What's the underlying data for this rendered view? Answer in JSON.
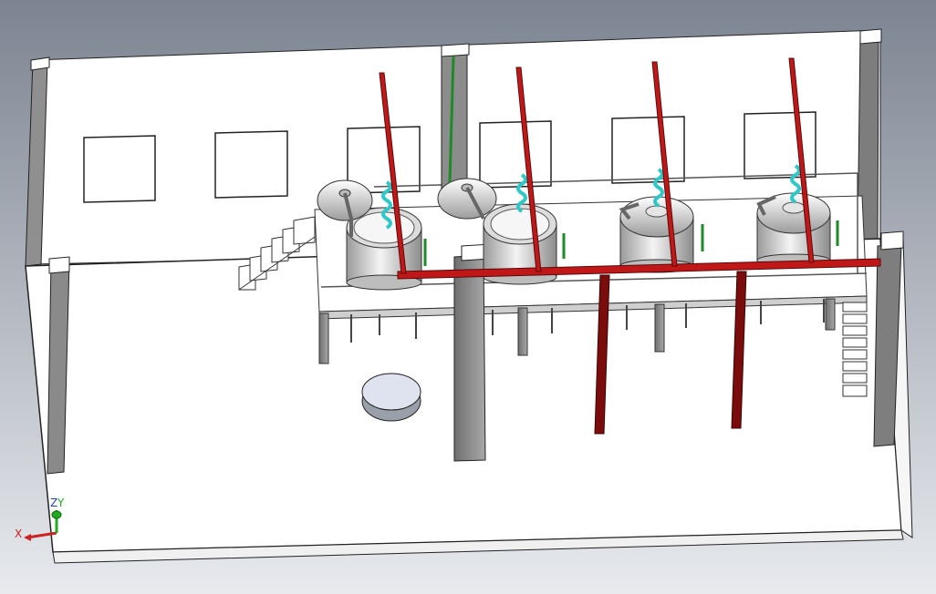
{
  "viewport": {
    "background_top": "#7c8491",
    "background_bottom": "#e8eaee"
  },
  "colors": {
    "floor": "#ffffff",
    "wall": "#ffffff",
    "wall_edge": "#222222",
    "column": "#8a8a8a",
    "pipe_red": "#c01818",
    "pipe_red_dark": "#7a0c0c",
    "coil_cyan": "#2fc7c7",
    "pipe_green": "#1e8a2a",
    "tank_metal": "#d8d8d8"
  },
  "triad": {
    "x_label": "X",
    "y_label": "Y",
    "z_label": "Z",
    "x_color": "#cc2222",
    "y_color": "#22aa22"
  },
  "model": {
    "tanks": [
      "tank-1",
      "tank-2",
      "tank-3",
      "tank-4"
    ],
    "lids": [
      "lid-1",
      "lid-2"
    ]
  }
}
